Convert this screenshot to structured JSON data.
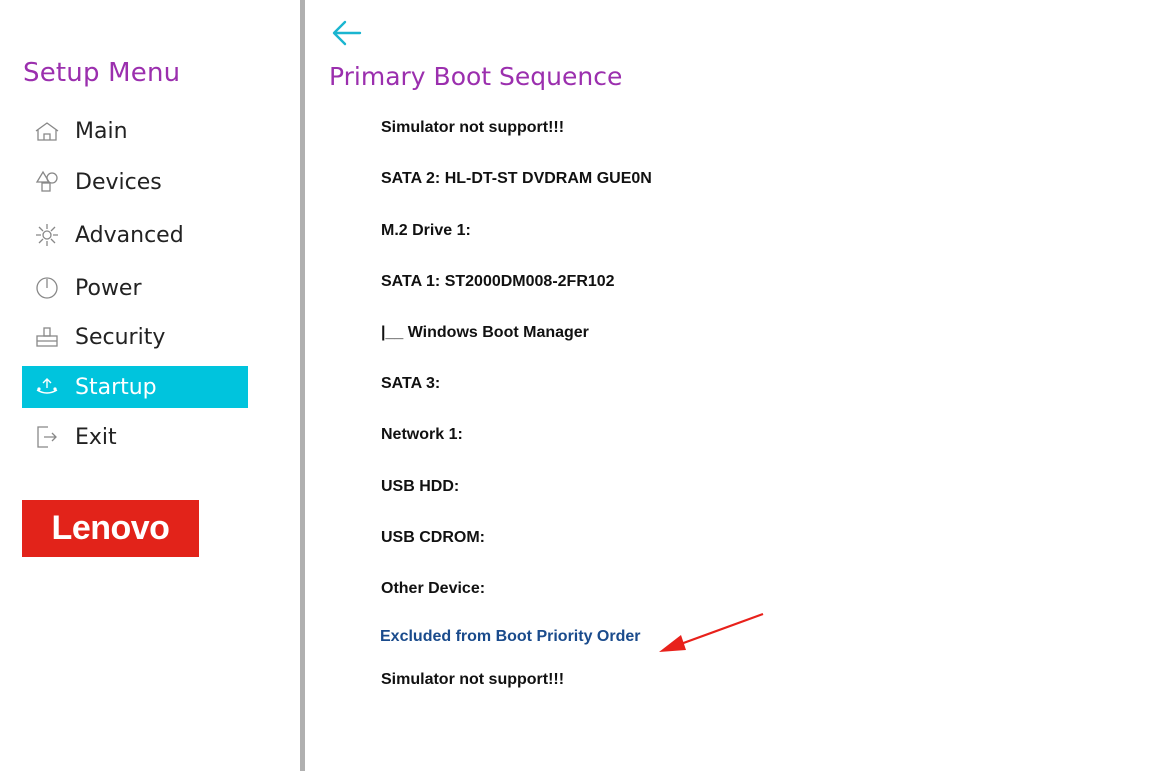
{
  "sidebar": {
    "title": "Setup Menu",
    "items": [
      {
        "label": "Main",
        "icon": "home-icon",
        "active": false
      },
      {
        "label": "Devices",
        "icon": "devices-icon",
        "active": false
      },
      {
        "label": "Advanced",
        "icon": "advanced-icon",
        "active": false
      },
      {
        "label": "Power",
        "icon": "power-icon",
        "active": false
      },
      {
        "label": "Security",
        "icon": "security-icon",
        "active": false
      },
      {
        "label": "Startup",
        "icon": "startup-icon",
        "active": true
      },
      {
        "label": "Exit",
        "icon": "exit-icon",
        "active": false
      }
    ],
    "logo": "Lenovo"
  },
  "main": {
    "title": "Primary Boot Sequence",
    "boot_items": [
      "Simulator not support!!!",
      "SATA 2: HL-DT-ST DVDRAM GUE0N",
      "M.2 Drive 1:",
      "SATA 1: ST2000DM008-2FR102",
      "|__ Windows Boot Manager",
      "SATA 3:",
      "Network 1:",
      "USB HDD:",
      "USB CDROM:",
      "Other Device:"
    ],
    "excluded_header": "Excluded from Boot Priority Order",
    "excluded_items": [
      "Simulator not support!!!"
    ]
  },
  "colors": {
    "accent": "#9b2fae",
    "active_bg": "#00c4dd",
    "logo_bg": "#e2231a",
    "excluded_header": "#1a4b8c",
    "annotation_arrow": "#e8211b"
  }
}
